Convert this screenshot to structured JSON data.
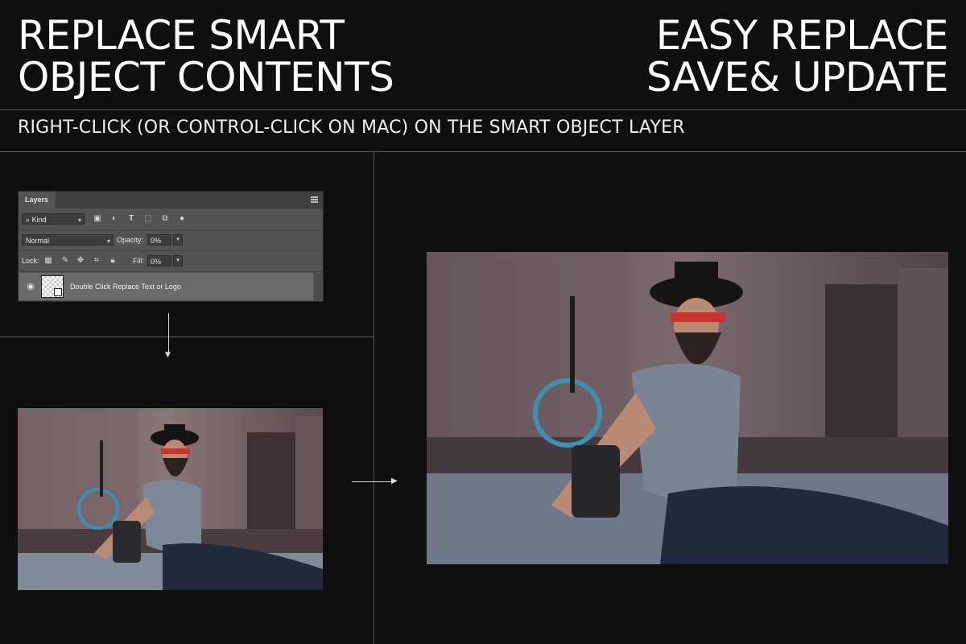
{
  "headline_left": {
    "line1": "REPLACE SMART",
    "line2": "OBJECT CONTENTS"
  },
  "headline_right": {
    "line1": "EASY REPLACE",
    "line2": "SAVE& UPDATE"
  },
  "subtitle": "RIGHT-CLICK (OR CONTROL-CLICK ON MAC) ON THE SMART OBJECT LAYER",
  "layers_panel": {
    "tab_label": "Layers",
    "filter_label": "Kind",
    "blend_mode": "Normal",
    "opacity_label": "Opacity:",
    "opacity_value": "0%",
    "lock_label": "Lock:",
    "fill_label": "Fill:",
    "fill_value": "0%",
    "layer_name": "Double Click Replace Text or Logo"
  },
  "colors": {
    "background": "#0f0f10",
    "text": "#ffffff",
    "divider": "#5a5a5a",
    "panel": "#535353",
    "selected_layer": "#6a6a6a"
  },
  "icons": {
    "search": "search-icon",
    "image_filter": "image-icon",
    "adjustment_filter": "adjustment-icon",
    "type_filter": "type-icon",
    "shape_filter": "shape-icon",
    "smart_object_filter": "smart-object-icon",
    "toggle": "filter-toggle-icon",
    "menu": "panel-menu-icon",
    "visibility": "eye-icon"
  }
}
